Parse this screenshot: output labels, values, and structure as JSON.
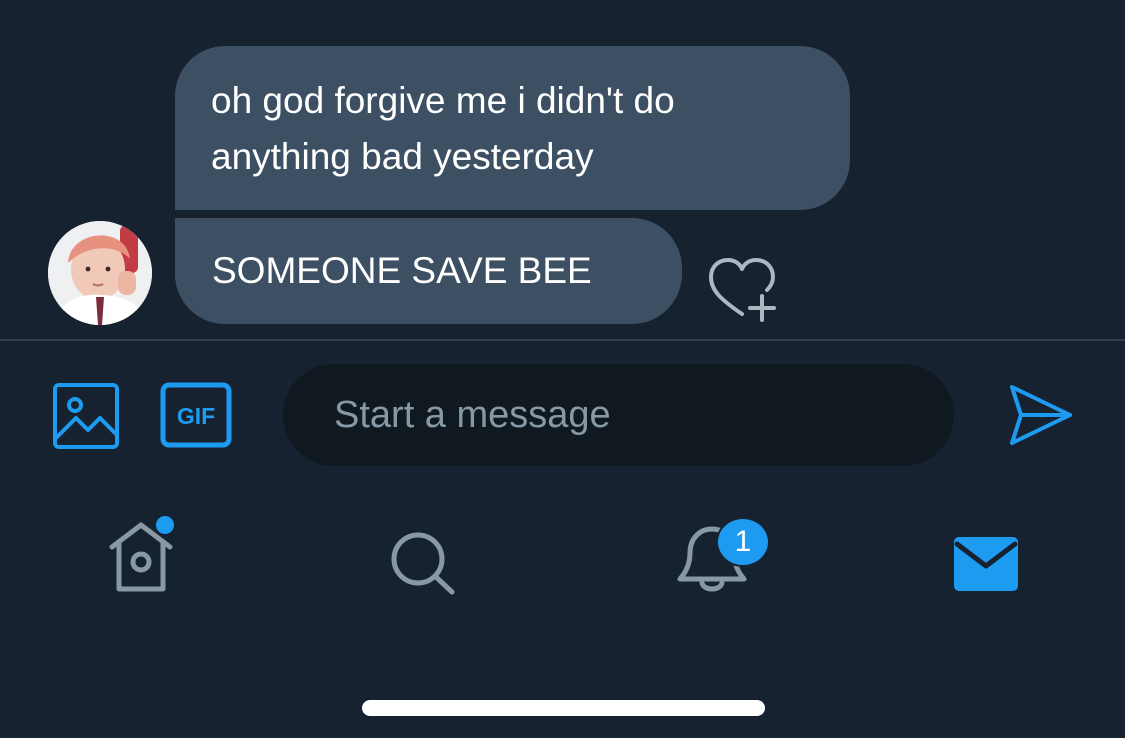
{
  "conversation": {
    "messages": [
      {
        "text": "oh god forgive me i didn't do anything bad yesterday"
      },
      {
        "text": "SOMEONE SAVE BEE"
      }
    ]
  },
  "compose": {
    "placeholder": "Start a message",
    "gif_label": "GIF"
  },
  "tab_bar": {
    "notification_count": "1"
  },
  "icons": {
    "image": "image-icon",
    "gif": "gif-icon",
    "send": "send-icon",
    "home": "home-icon",
    "search": "search-icon",
    "notifications": "bell-icon",
    "messages": "mail-icon",
    "like": "heart-plus-icon"
  },
  "colors": {
    "background": "#172230",
    "bubble": "#3d5063",
    "accent": "#1d9bf0",
    "muted": "#8899a6",
    "input_background": "#101820"
  }
}
